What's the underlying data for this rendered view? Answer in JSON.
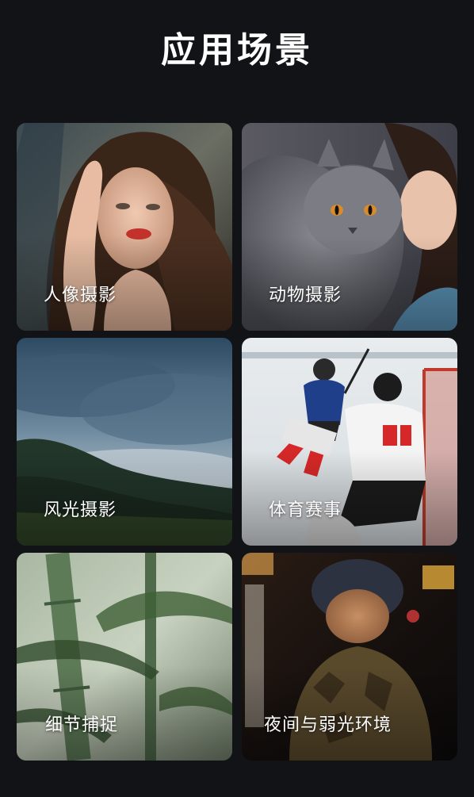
{
  "header": {
    "title": "应用场景"
  },
  "scenarios": [
    {
      "label": "人像摄影",
      "image": "portrait-photo"
    },
    {
      "label": "动物摄影",
      "image": "animal-photo"
    },
    {
      "label": "风光摄影",
      "image": "landscape-photo"
    },
    {
      "label": "体育赛事",
      "image": "sports-photo"
    },
    {
      "label": "细节捕捉",
      "image": "detail-photo"
    },
    {
      "label": "夜间与弱光环境",
      "image": "night-lowlight-photo"
    }
  ]
}
